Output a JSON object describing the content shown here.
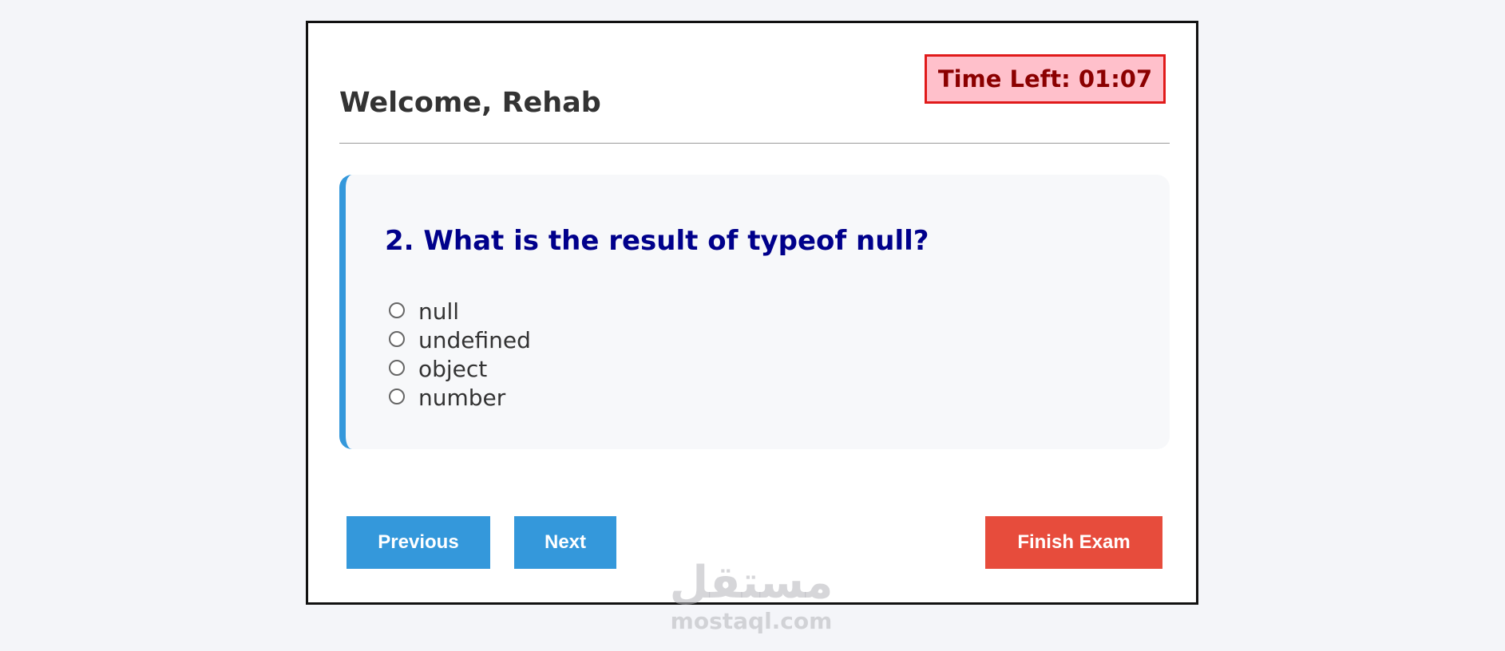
{
  "header": {
    "welcome": "Welcome, Rehab",
    "timer": "Time Left: 01:07"
  },
  "question": {
    "text": "2. What is the result of typeof null?",
    "options": [
      "null",
      "undefined",
      "object",
      "number"
    ],
    "selected": null
  },
  "buttons": {
    "previous": "Previous",
    "next": "Next",
    "finish": "Finish Exam"
  },
  "watermark": {
    "arabic": "مستقل",
    "latin": "mostaql.com"
  },
  "colors": {
    "accent": "#3498db",
    "danger": "#e74c3c",
    "question_text": "#00008b",
    "timer_bg": "#ffc0cb",
    "timer_text": "#8b0000"
  }
}
